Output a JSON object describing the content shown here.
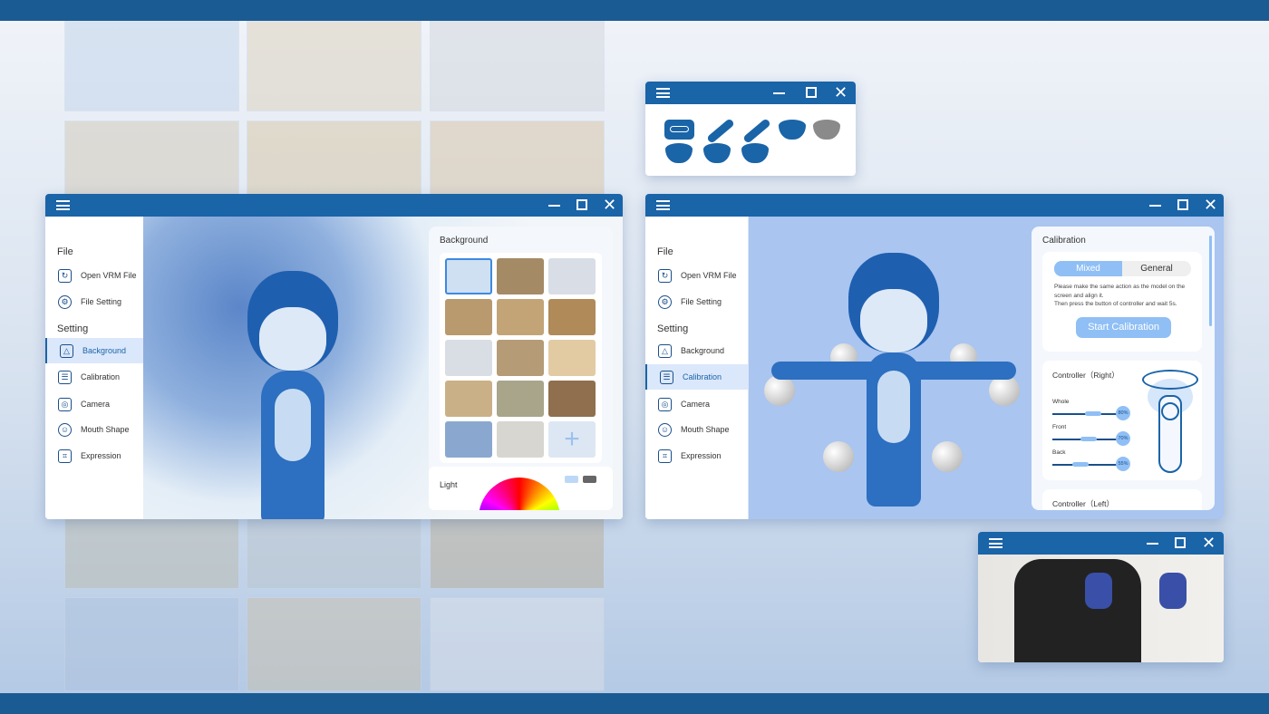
{
  "left_window": {
    "sidebar": {
      "file_header": "File",
      "items_file": [
        {
          "label": "Open VRM File",
          "icon": "refresh-file-icon"
        },
        {
          "label": "File Setting",
          "icon": "gear-icon"
        }
      ],
      "setting_header": "Setting",
      "items_setting": [
        {
          "label": "Background",
          "icon": "triangle-icon",
          "active": true
        },
        {
          "label": "Calibration",
          "icon": "list-icon"
        },
        {
          "label": "Camera",
          "icon": "camera-icon"
        },
        {
          "label": "Mouth Shape",
          "icon": "smile-icon"
        },
        {
          "label": "Expression",
          "icon": "face-scan-icon"
        }
      ]
    },
    "panel": {
      "title": "Background",
      "light_label": "Light",
      "add_icon": "plus-icon"
    }
  },
  "right_window": {
    "sidebar": {
      "file_header": "File",
      "items_file": [
        {
          "label": "Open VRM File"
        },
        {
          "label": "File Setting"
        }
      ],
      "setting_header": "Setting",
      "items_setting": [
        {
          "label": "Background"
        },
        {
          "label": "Calibration",
          "active": true
        },
        {
          "label": "Camera"
        },
        {
          "label": "Mouth Shape"
        },
        {
          "label": "Expression"
        }
      ]
    },
    "panel": {
      "title": "Calibration",
      "tabs": [
        "Mixed",
        "General"
      ],
      "active_tab": "Mixed",
      "instructions_1": "Please make the same action as the model on the screen and align it.",
      "instructions_2": "Then press the button of controller and wait 5s.",
      "start_button": "Start Calibration",
      "controller_right": {
        "title": "Controller（Right）",
        "sliders": [
          {
            "label": "Whole",
            "value": "80%",
            "level": 80
          },
          {
            "label": "Front",
            "value": "70%",
            "level": 70
          },
          {
            "label": "Back",
            "value": "55%",
            "level": 55
          }
        ]
      },
      "controller_left_title": "Controller（Left）"
    }
  },
  "colors": {
    "brand": "#1a64a8",
    "accent": "#8fbff5",
    "viewport": "#a9c5f0"
  }
}
